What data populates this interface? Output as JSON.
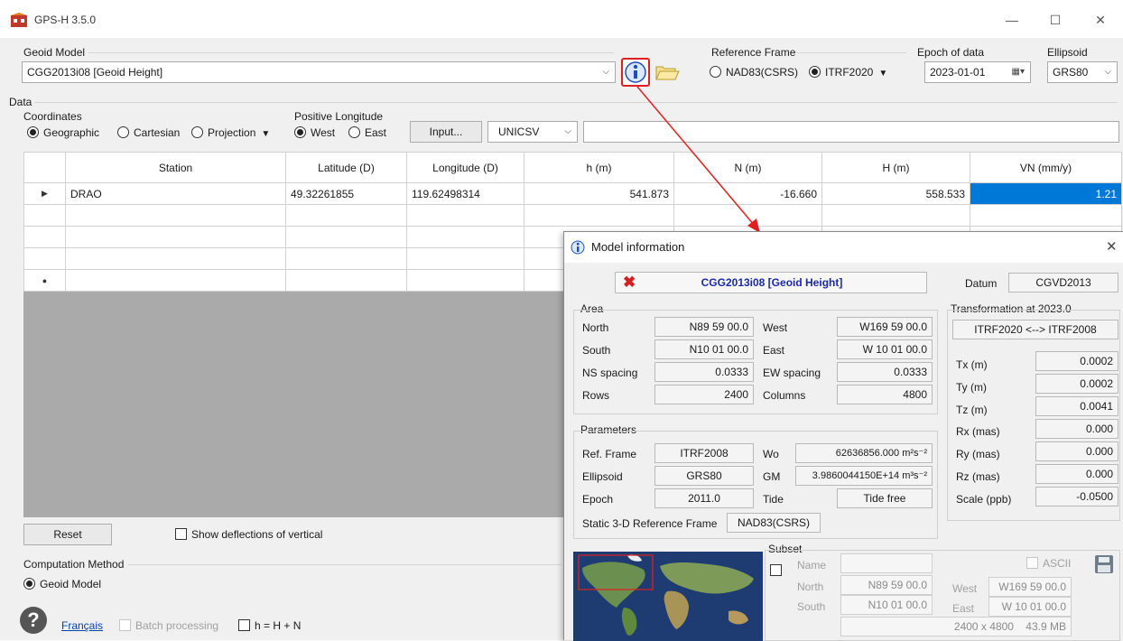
{
  "window": {
    "title": "GPS-H 3.5.0"
  },
  "geoid_model": {
    "label": "Geoid Model",
    "selected": "CGG2013i08 [Geoid Height]"
  },
  "reference_frame": {
    "label": "Reference Frame",
    "options": [
      "NAD83(CSRS)",
      "ITRF2020"
    ],
    "selected": "ITRF2020"
  },
  "epoch": {
    "label": "Epoch of data",
    "value": "2023-01-01"
  },
  "ellipsoid": {
    "label": "Ellipsoid",
    "value": "GRS80"
  },
  "data_section": {
    "label": "Data",
    "coordinates": {
      "label": "Coordinates",
      "options": [
        "Geographic",
        "Cartesian",
        "Projection"
      ],
      "selected": "Geographic"
    },
    "positive_longitude": {
      "label": "Positive Longitude",
      "options": [
        "West",
        "East"
      ],
      "selected": "West"
    },
    "input_button": "Input...",
    "format": "UNICSV",
    "file_path": ""
  },
  "table": {
    "columns": [
      "Station",
      "Latitude (D)",
      "Longitude (D)",
      "h (m)",
      "N (m)",
      "H (m)",
      "VN (mm/y)"
    ],
    "rows": [
      {
        "station": "DRAO",
        "lat": "49.32261855",
        "lon": "119.62498314",
        "h": "541.873",
        "n": "-16.660",
        "H": "558.533",
        "vn": "1.21"
      }
    ]
  },
  "bottom": {
    "reset_button": "Reset",
    "show_deflections": "Show deflections of vertical",
    "computation_method": {
      "label": "Computation Method",
      "option": "Geoid Model"
    },
    "francais_link": "Français",
    "batch_processing": "Batch processing",
    "h_eq": "h = H + N"
  },
  "dialog": {
    "title": "Model information",
    "model_name": "CGG2013i08 [Geoid Height]",
    "datum_label": "Datum",
    "datum_value": "CGVD2013",
    "area": {
      "label": "Area",
      "north_label": "North",
      "north": "N89 59 00.0",
      "west_label": "West",
      "west": "W169 59 00.0",
      "south_label": "South",
      "south": "N10 01 00.0",
      "east_label": "East",
      "east": "W 10 01 00.0",
      "ns_label": "NS spacing",
      "ns": "0.0333",
      "ew_label": "EW spacing",
      "ew": "0.0333",
      "rows_label": "Rows",
      "rows": "2400",
      "cols_label": "Columns",
      "cols": "4800"
    },
    "parameters": {
      "label": "Parameters",
      "ref_frame_label": "Ref. Frame",
      "ref_frame": "ITRF2008",
      "wo_label": "Wo",
      "wo": "62636856.000 m²s⁻²",
      "ellipsoid_label": "Ellipsoid",
      "ellipsoid": "GRS80",
      "gm_label": "GM",
      "gm": "3.9860044150E+14 m³s⁻²",
      "epoch_label": "Epoch",
      "epoch": "2011.0",
      "tide_label": "Tide",
      "tide": "Tide free",
      "static_label": "Static 3-D Reference Frame",
      "static": "NAD83(CSRS)"
    },
    "transformation": {
      "label": "Transformation at 2023.0",
      "name": "ITRF2020 <--> ITRF2008",
      "params": [
        {
          "label": "Tx (m)",
          "value": "0.0002"
        },
        {
          "label": "Ty (m)",
          "value": "0.0002"
        },
        {
          "label": "Tz (m)",
          "value": "0.0041"
        },
        {
          "label": "Rx (mas)",
          "value": "0.000"
        },
        {
          "label": "Ry (mas)",
          "value": "0.000"
        },
        {
          "label": "Rz (mas)",
          "value": "0.000"
        },
        {
          "label": "Scale (ppb)",
          "value": "-0.0500"
        }
      ]
    },
    "subset": {
      "label": "Subset",
      "name_label": "Name",
      "name": "",
      "ascii_label": "ASCII",
      "north_label": "North",
      "north": "N89 59 00.0",
      "west_label": "West",
      "west": "W169 59 00.0",
      "south_label": "South",
      "south": "N10 01 00.0",
      "east_label": "East",
      "east": "W 10 01 00.0",
      "size": "2400 x 4800    43.9 MB"
    }
  }
}
